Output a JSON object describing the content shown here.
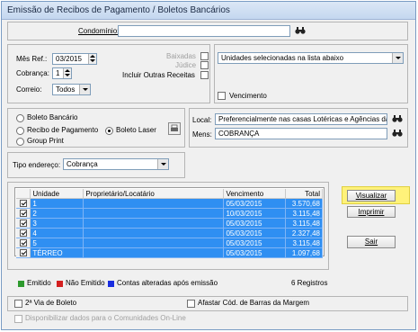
{
  "window": {
    "title": "Emissão de Recibos de Pagamento / Boletos Bancários"
  },
  "condominio": {
    "label": "Condomínio:",
    "value": ""
  },
  "mes_ref": {
    "label": "Mês Ref.:",
    "value": "03/2015"
  },
  "cobranca": {
    "label": "Cobrança:",
    "value": "1"
  },
  "correio": {
    "label": "Correio:",
    "value": "Todos"
  },
  "checks": {
    "baixadas": "Baixadas",
    "judice": "Júdice",
    "incluir": "Incluir Outras Receitas"
  },
  "unidades": {
    "value": "Unidades selecionadas na lista abaixo",
    "vencimento": "Vencimento"
  },
  "tipo": {
    "boleto_bancario": "Boleto Bancário",
    "recibo": "Recibo de Pagamento",
    "boleto_laser": "Boleto Laser",
    "group_print": "Group Print"
  },
  "local": {
    "label": "Local:",
    "value": "Preferencialmente nas casas Lotéricas e Agências da"
  },
  "mens": {
    "label": "Mens:",
    "value": "COBRANÇA"
  },
  "tipo_endereco": {
    "label": "Tipo endereço:",
    "value": "Cobrança"
  },
  "table": {
    "headers": [
      "Unidade",
      "Proprietário/Locatário",
      "Vencimento",
      "Total"
    ],
    "rows": [
      {
        "unidade": "1",
        "prop": "",
        "venc": "05/03/2015",
        "total": "3.570,68"
      },
      {
        "unidade": "2",
        "prop": "",
        "venc": "10/03/2015",
        "total": "3.115,48"
      },
      {
        "unidade": "3",
        "prop": "",
        "venc": "05/03/2015",
        "total": "3.115,48"
      },
      {
        "unidade": "4",
        "prop": "",
        "venc": "05/03/2015",
        "total": "2.327,48"
      },
      {
        "unidade": "5",
        "prop": "",
        "venc": "05/03/2015",
        "total": "3.115,48"
      },
      {
        "unidade": "TÉRREO",
        "prop": "",
        "venc": "05/03/2015",
        "total": "1.097,68"
      }
    ]
  },
  "buttons": {
    "visualizar": "Visualizar",
    "imprimir": "Imprimir",
    "sair": "Sair"
  },
  "legend": {
    "emitido": "Emitido",
    "nao_emitido": "Não Emitido",
    "alteradas": "Contas alteradas após emissão",
    "registros": "6 Registros"
  },
  "bottom": {
    "segunda_via": "2ª Via de Boleto",
    "afastar": "Afastar Cód. de Barras da Margem",
    "disponibilizar": "Disponibilizar dados para o Comunidades On-Line"
  },
  "colors": {
    "emitido": "#2e9a2e",
    "nao_emitido": "#d42020",
    "alteradas": "#1a2ee0",
    "highlight": "#fff27a",
    "row_selected": "#2f8ff2"
  }
}
